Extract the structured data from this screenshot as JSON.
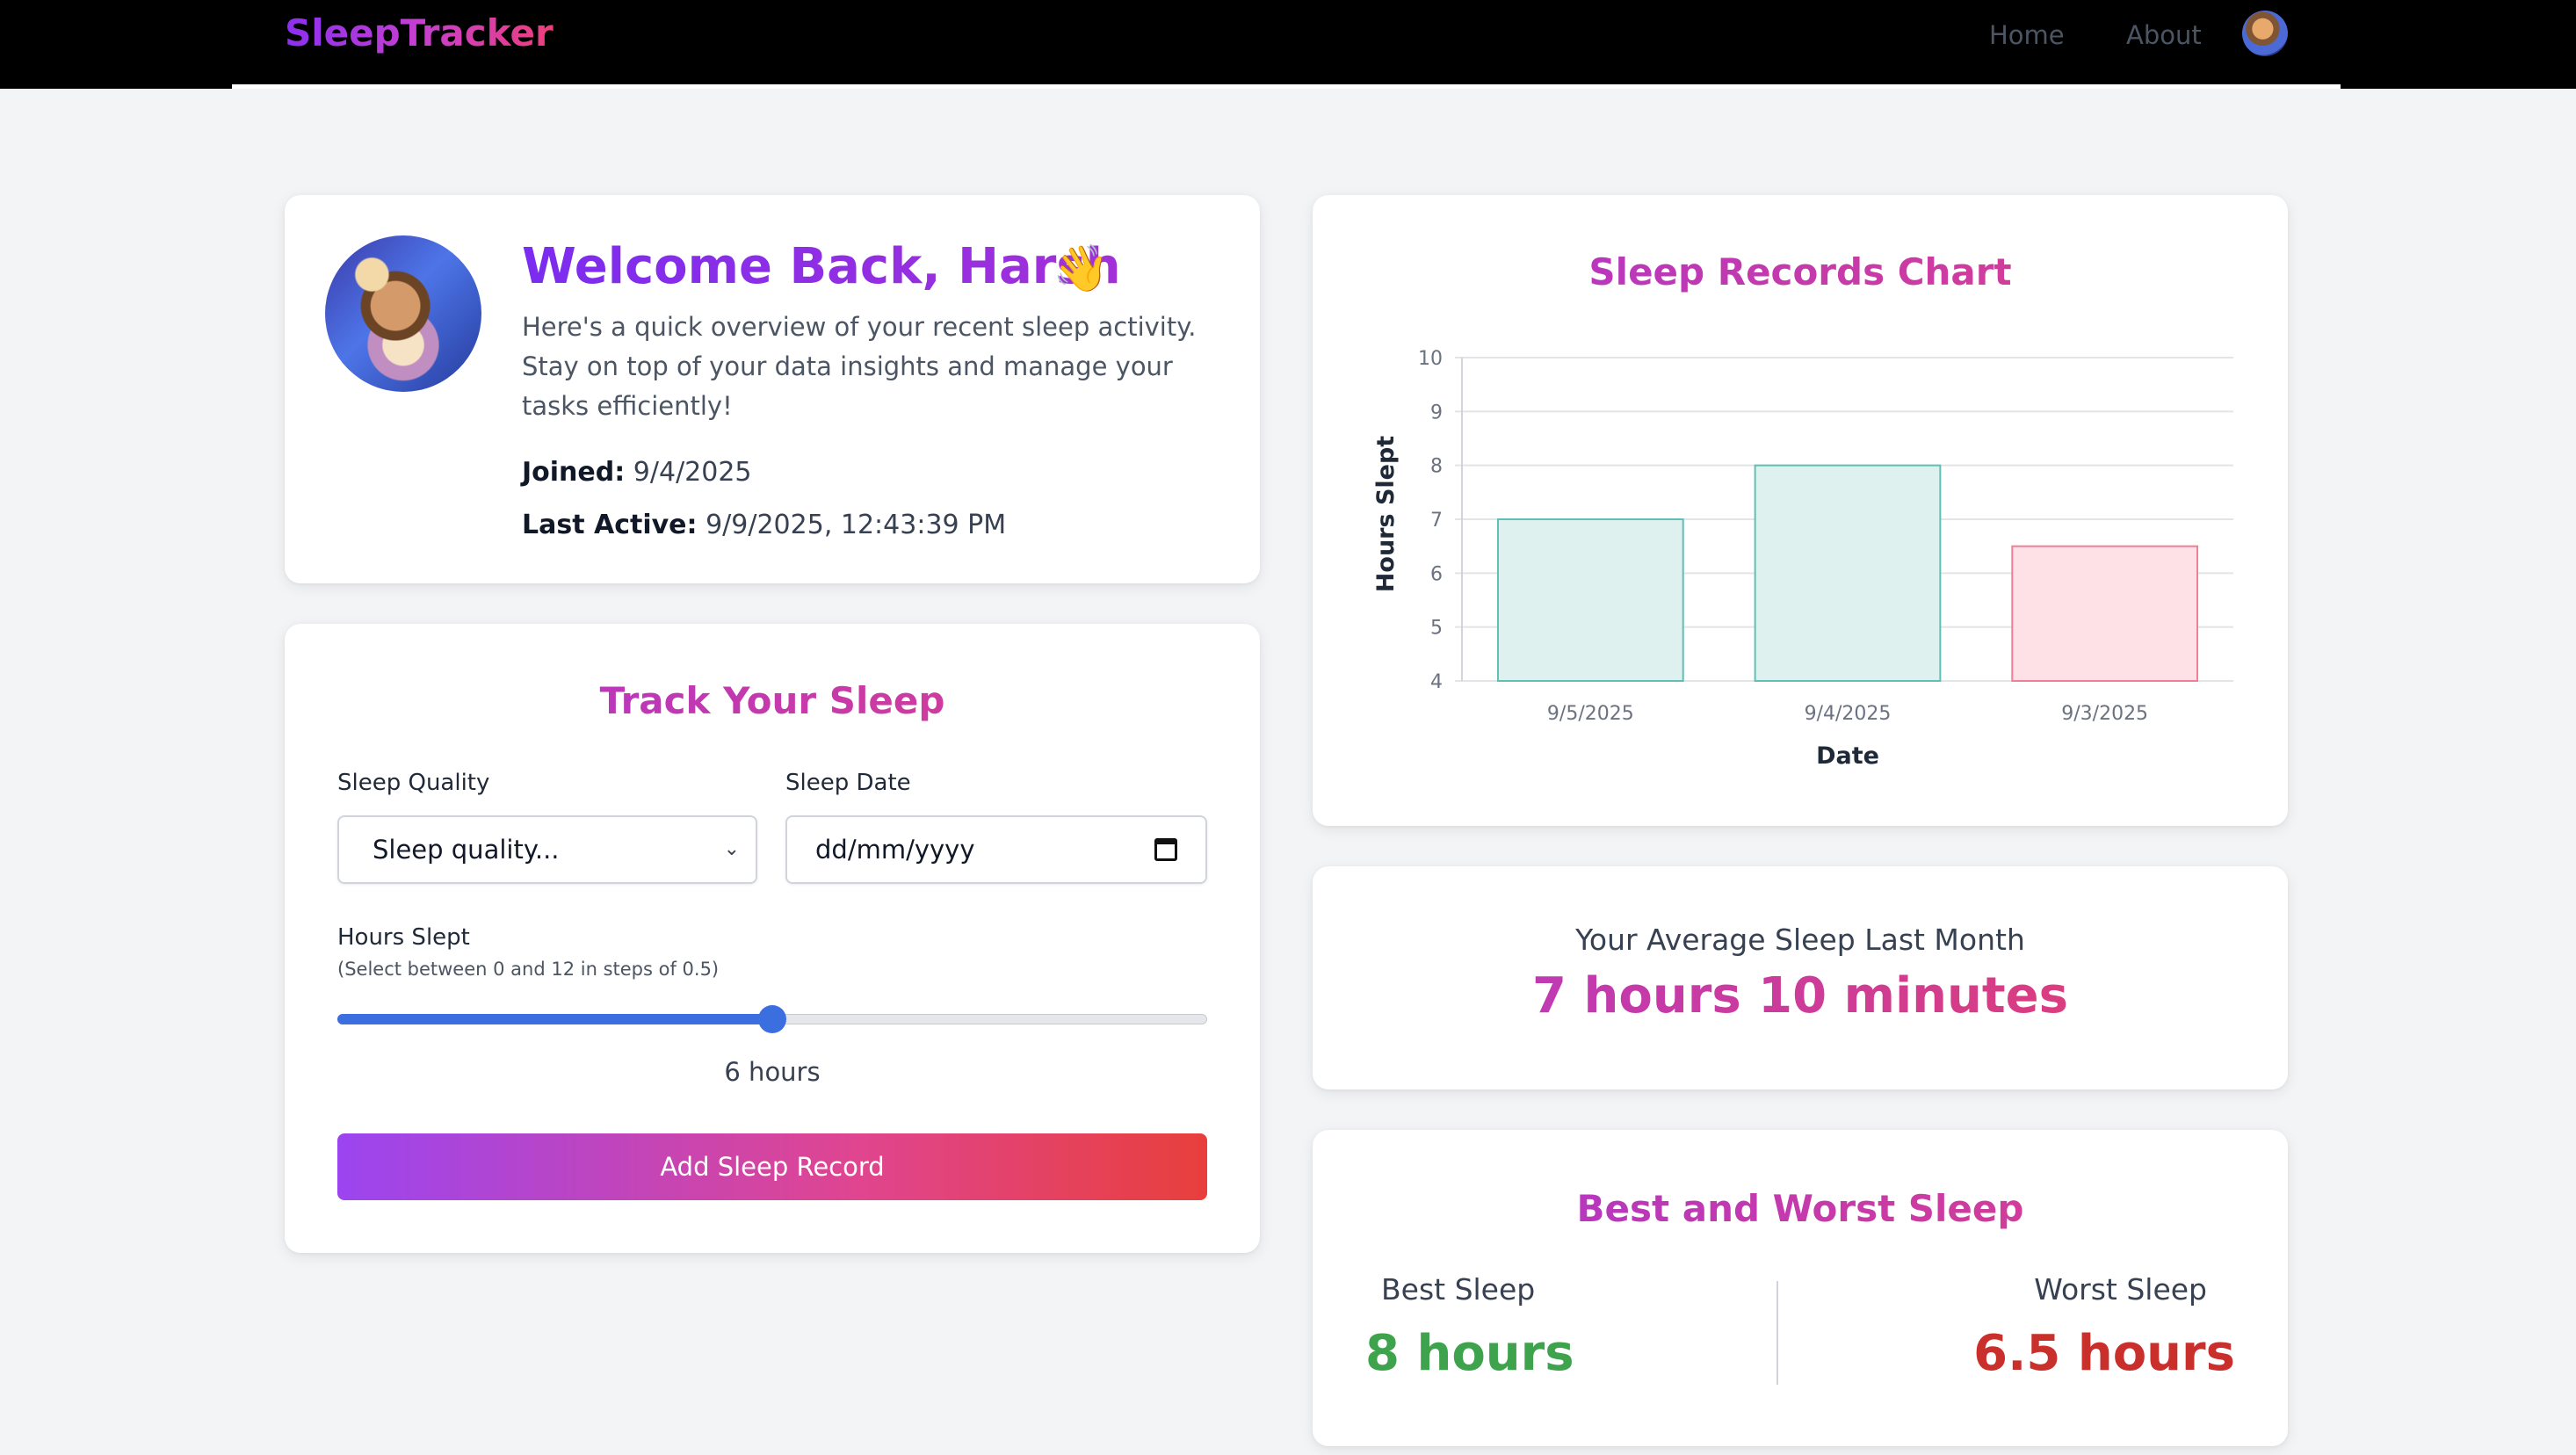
{
  "nav": {
    "brand": "SleepTracker",
    "links": [
      "Home",
      "About"
    ]
  },
  "profile": {
    "welcome": "Welcome Back, Harsh",
    "wave": "👋",
    "intro": "Here's a quick overview of your recent sleep activity. Stay on top of your data insights and manage your tasks efficiently!",
    "joined_label": "Joined:",
    "joined_value": "9/4/2025",
    "last_active_label": "Last Active:",
    "last_active_value": "9/9/2025, 12:43:39 PM"
  },
  "tracker": {
    "title": "Track Your Sleep",
    "quality_label": "Sleep Quality",
    "quality_value": "Sleep quality...",
    "date_label": "Sleep Date",
    "date_placeholder": "dd/mm/yyyy",
    "hours_label": "Hours Slept",
    "hours_hint": "(Select between 0 and 12 in steps of 0.5)",
    "hours_value": "6 hours",
    "slider_min": 0,
    "slider_max": 12,
    "slider_value": 6,
    "add_button": "Add Sleep Record"
  },
  "chart_data": {
    "type": "bar",
    "title": "Sleep Records Chart",
    "categories": [
      "9/5/2025",
      "9/4/2025",
      "9/3/2025"
    ],
    "values": [
      7,
      8,
      6.5
    ],
    "xlabel": "Date",
    "ylabel": "Hours Slept",
    "ylim": [
      4,
      10
    ],
    "yticks": [
      "4",
      "5",
      "6",
      "7",
      "8",
      "9",
      "10"
    ],
    "grid": true,
    "bar_fill_colors": [
      "#dff1ef",
      "#dff1ef",
      "#fde1e6"
    ],
    "bar_stroke_colors": [
      "#5fbfb4",
      "#5fbfb4",
      "#ee7f95"
    ]
  },
  "average": {
    "label": "Your Average Sleep Last Month",
    "value": "7 hours 10 minutes"
  },
  "best_worst": {
    "title": "Best and Worst Sleep",
    "best_label": "Best Sleep",
    "best_value": "8 hours",
    "best_color": "#3fa34d",
    "worst_label": "Worst Sleep",
    "worst_value": "6.5 hours",
    "worst_color": "#c9302c"
  }
}
